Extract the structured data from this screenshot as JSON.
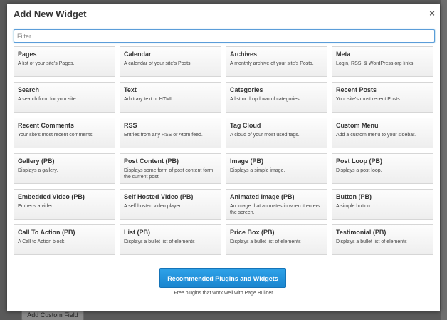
{
  "background": {
    "add_custom_field_label": "Add Custom Field"
  },
  "modal": {
    "title": "Add New Widget",
    "close_label": "×",
    "filter_placeholder": "Filter",
    "widgets": [
      {
        "title": "Pages",
        "desc": "A list of your site's Pages."
      },
      {
        "title": "Calendar",
        "desc": "A calendar of your site's Posts."
      },
      {
        "title": "Archives",
        "desc": "A monthly archive of your site's Posts."
      },
      {
        "title": "Meta",
        "desc": "Login, RSS, & WordPress.org links."
      },
      {
        "title": "Search",
        "desc": "A search form for your site."
      },
      {
        "title": "Text",
        "desc": "Arbitrary text or HTML."
      },
      {
        "title": "Categories",
        "desc": "A list or dropdown of categories."
      },
      {
        "title": "Recent Posts",
        "desc": "Your site's most recent Posts."
      },
      {
        "title": "Recent Comments",
        "desc": "Your site's most recent comments."
      },
      {
        "title": "RSS",
        "desc": "Entries from any RSS or Atom feed."
      },
      {
        "title": "Tag Cloud",
        "desc": "A cloud of your most used tags."
      },
      {
        "title": "Custom Menu",
        "desc": "Add a custom menu to your sidebar."
      },
      {
        "title": "Gallery (PB)",
        "desc": "Displays a gallery."
      },
      {
        "title": "Post Content (PB)",
        "desc": "Displays some form of post content form the current post."
      },
      {
        "title": "Image (PB)",
        "desc": "Displays a simple image."
      },
      {
        "title": "Post Loop (PB)",
        "desc": "Displays a post loop."
      },
      {
        "title": "Embedded Video (PB)",
        "desc": "Embeds a video."
      },
      {
        "title": "Self Hosted Video (PB)",
        "desc": "A self hosted video player."
      },
      {
        "title": "Animated Image (PB)",
        "desc": "An image that animates in when it enters the screen."
      },
      {
        "title": "Button (PB)",
        "desc": "A simple button"
      },
      {
        "title": "Call To Action (PB)",
        "desc": "A Call to Action block"
      },
      {
        "title": "List (PB)",
        "desc": "Displays a bullet list of elements"
      },
      {
        "title": "Price Box (PB)",
        "desc": "Displays a bullet list of elements"
      },
      {
        "title": "Testimonial (PB)",
        "desc": "Displays a bullet list of elements"
      }
    ],
    "recommended_button_label": "Recommended Plugins and Widgets",
    "recommended_caption": "Free plugins that work well with Page Builder"
  },
  "colors": {
    "accent": "#2ea2e8",
    "modal_bg": "#ffffff",
    "overlay": "#5a5a5a"
  }
}
